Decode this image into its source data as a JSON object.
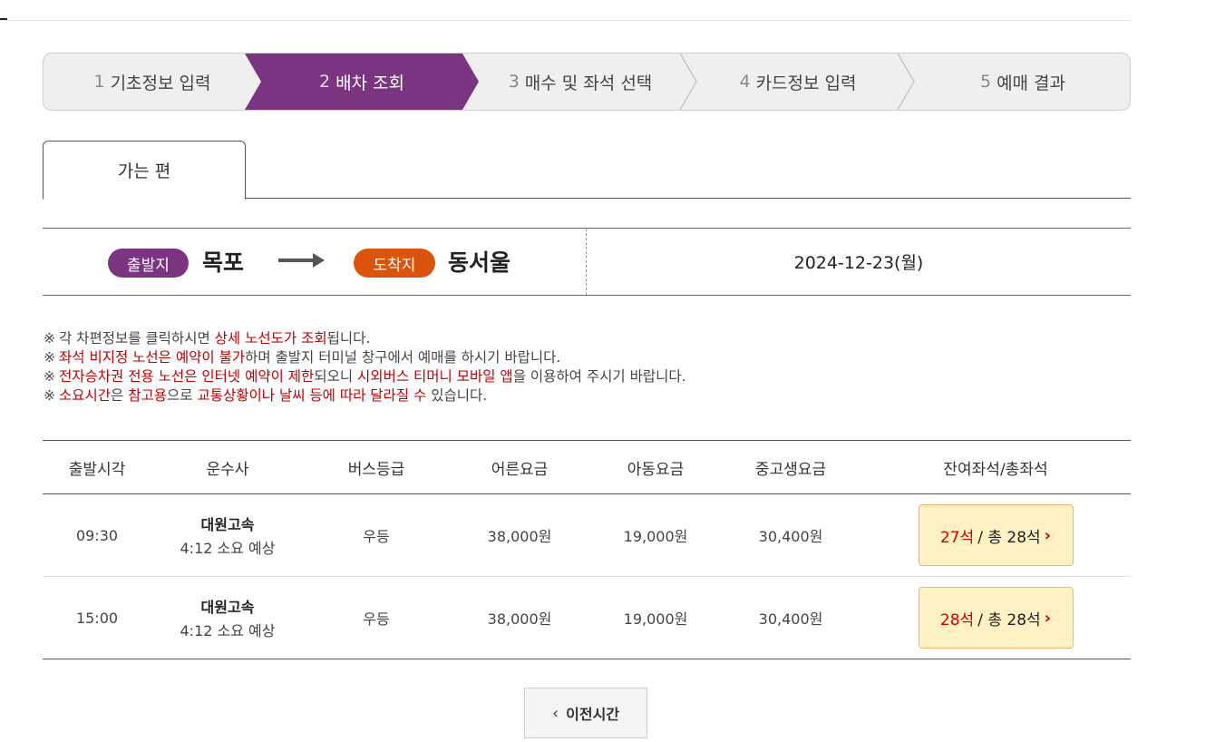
{
  "steps": [
    {
      "num": "1",
      "label": "기초정보 입력"
    },
    {
      "num": "2",
      "label": "배차 조회"
    },
    {
      "num": "3",
      "label": "매수 및 좌석 선택"
    },
    {
      "num": "4",
      "label": "카드정보 입력"
    },
    {
      "num": "5",
      "label": "예매 결과"
    }
  ],
  "tab": {
    "label": "가는 편"
  },
  "route": {
    "departure_badge": "출발지",
    "departure_city": "목포",
    "arrival_badge": "도착지",
    "arrival_city": "동서울",
    "date": "2024-12-23(월)"
  },
  "notes": [
    {
      "mark": "※",
      "parts": [
        {
          "t": "각 차편정보를 클릭하시면 ",
          "red": false
        },
        {
          "t": "상세 노선도가 조회",
          "red": true
        },
        {
          "t": "됩니다.",
          "red": false
        }
      ]
    },
    {
      "mark": "※",
      "parts": [
        {
          "t": "좌석 비지정 노선은 예약이 불가",
          "red": true
        },
        {
          "t": "하며 출발지 터미널 창구에서 예매를 하시기 바랍니다.",
          "red": false
        }
      ]
    },
    {
      "mark": "※",
      "parts": [
        {
          "t": "전자승차권 전용 노선은 인터넷 예약이 제한",
          "red": true
        },
        {
          "t": "되오니 ",
          "red": false
        },
        {
          "t": "시외버스 티머니 모바일 앱",
          "red": true
        },
        {
          "t": "을 이용하여 주시기 바랍니다.",
          "red": false
        }
      ]
    },
    {
      "mark": "※",
      "parts": [
        {
          "t": "소요시간",
          "red": true
        },
        {
          "t": "은 ",
          "red": false
        },
        {
          "t": "참고용",
          "red": true
        },
        {
          "t": "으로 ",
          "red": false
        },
        {
          "t": "교통상황이나 날씨 등에 따라 달라질 수",
          "red": true
        },
        {
          "t": " 있습니다.",
          "red": false
        }
      ]
    }
  ],
  "table": {
    "headers": [
      "출발시각",
      "운수사",
      "버스등급",
      "어른요금",
      "아동요금",
      "중고생요금",
      "잔여좌석/총좌석"
    ],
    "rows": [
      {
        "time": "09:30",
        "company": "대원고속",
        "duration": "4:12 소요 예상",
        "grade": "우등",
        "adult": "38,000원",
        "child": "19,000원",
        "student": "30,400원",
        "remain": "27석",
        "total": "/ 총 28석"
      },
      {
        "time": "15:00",
        "company": "대원고속",
        "duration": "4:12 소요 예상",
        "grade": "우등",
        "adult": "38,000원",
        "child": "19,000원",
        "student": "30,400원",
        "remain": "28석",
        "total": "/ 총 28석"
      }
    ]
  },
  "prev_button": {
    "label": "이전시간"
  },
  "icons": {
    "step_separator": "chevron-right-icon",
    "route_arrow": "arrow-right-icon",
    "seat_chevron": "chevron-right-icon",
    "prev_chevron": "chevron-left-icon"
  },
  "colors": {
    "accent_purple": "#7a3480",
    "arrival_orange": "#d9550d",
    "seat_bg": "#fff1c4",
    "seat_red": "#d40000"
  }
}
